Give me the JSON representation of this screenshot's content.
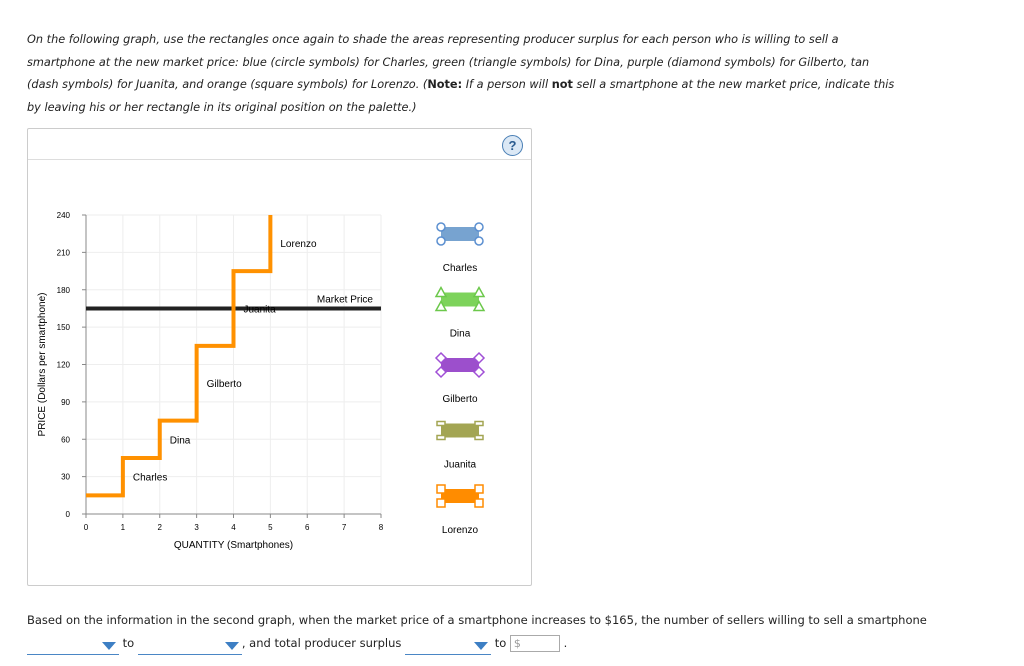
{
  "instructions": {
    "part1": "On the following graph, use the rectangles once again to shade the areas representing producer surplus for each person who is willing to sell a smartphone at the new market price: blue (circle symbols) for Charles, green (triangle symbols) for Dina, purple (diamond symbols) for Gilberto, tan (dash symbols) for Juanita, and orange (square symbols) for Lorenzo. (",
    "note": "Note:",
    "part2": " If a person will ",
    "not": "not",
    "part3": " sell a smartphone at the new market price, indicate this by leaving his or her rectangle in its original position on the palette.)"
  },
  "help_label": "?",
  "chart_data": {
    "type": "line",
    "xlabel": "QUANTITY (Smartphones)",
    "ylabel": "PRICE (Dollars per smartphone)",
    "xlim": [
      0,
      8
    ],
    "ylim": [
      0,
      240
    ],
    "xticks": [
      0,
      1,
      2,
      3,
      4,
      5,
      6,
      7,
      8
    ],
    "yticks": [
      0,
      30,
      60,
      90,
      120,
      150,
      180,
      210,
      240
    ],
    "grid": true,
    "supply_steps": [
      {
        "name": "Charles",
        "price": 15,
        "from": 0,
        "to": 1
      },
      {
        "name": "Dina",
        "price": 45,
        "from": 1,
        "to": 2
      },
      {
        "name": "Gilberto",
        "price": 75,
        "from": 2,
        "to": 3
      },
      {
        "name": "Juanita",
        "price": 135,
        "from": 3,
        "to": 4
      },
      {
        "name": "Lorenzo",
        "price": 195,
        "from": 4,
        "to": 5
      }
    ],
    "supply_end": {
      "x": 5,
      "y": 240
    },
    "supply_color": "#ff9100",
    "market_price": {
      "label": "Market Price",
      "value": 165,
      "color": "#222222"
    }
  },
  "palette": [
    {
      "name": "Charles",
      "color": "#77a3d0",
      "stroke": "#5b8fd0",
      "symbol": "circle"
    },
    {
      "name": "Dina",
      "color": "#7dd35b",
      "stroke": "#6cc84b",
      "symbol": "triangle"
    },
    {
      "name": "Gilberto",
      "color": "#9c4fcc",
      "stroke": "#a04fd6",
      "symbol": "diamond"
    },
    {
      "name": "Juanita",
      "color": "#a3a553",
      "stroke": "#a3a553",
      "symbol": "dash"
    },
    {
      "name": "Lorenzo",
      "color": "#ff8c00",
      "stroke": "#ff8c00",
      "symbol": "square"
    }
  ],
  "question": {
    "text1": "Based on the information in the second graph, when the market price of a smartphone increases to $165, the number of sellers willing to sell a smartphone",
    "to1": "to",
    "text2": ", and total producer surplus",
    "to2": "to",
    "currency": "$",
    "end": "."
  }
}
